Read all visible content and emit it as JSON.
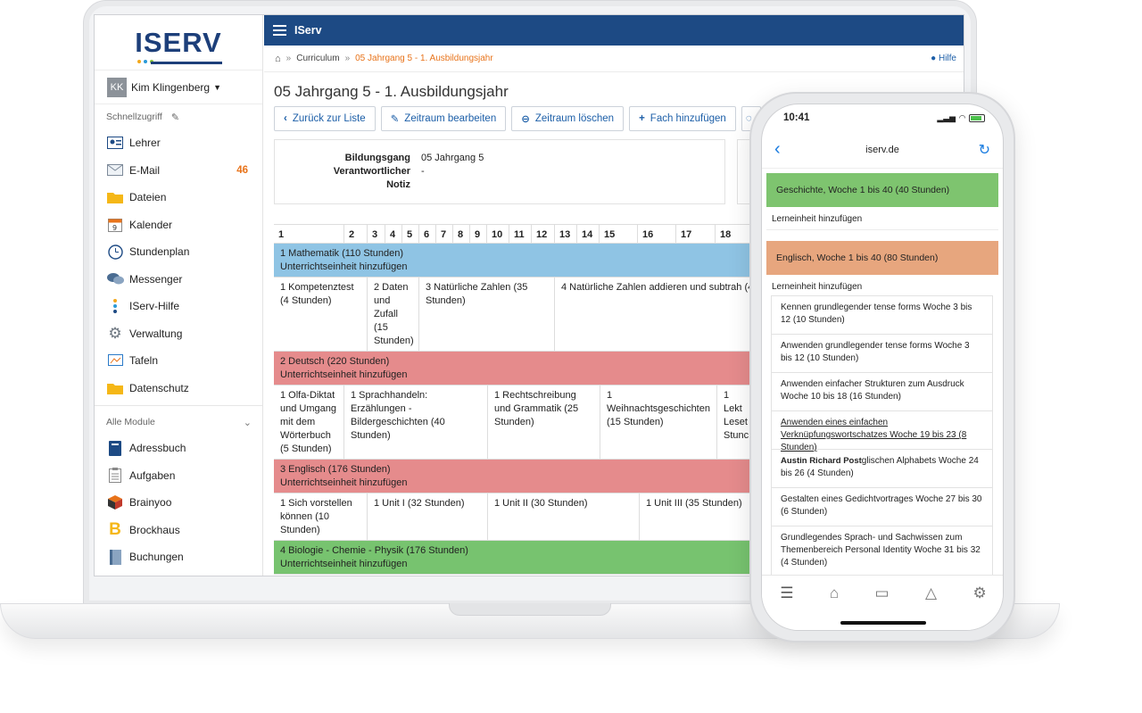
{
  "colors": {
    "brand_blue": "#1d4a84",
    "accent_orange": "#e8731a",
    "link_blue": "#1d5fa8",
    "mathematik": "#8fc4e4",
    "deutsch": "#e58b8c",
    "englisch": "#e58b8c",
    "biologie": "#77c36f",
    "phone_geschichte": "#7ec46f",
    "phone_englisch": "#e7a67e"
  },
  "sidebar": {
    "logo": "ISERV",
    "user": {
      "initials": "KK",
      "name": "Kim Klingenberg"
    },
    "quick_header": "Schnellzugriff",
    "quick_items": [
      {
        "label": "Lehrer",
        "icon": "teacher-card-icon"
      },
      {
        "label": "E-Mail",
        "icon": "envelope-icon",
        "badge": "46"
      },
      {
        "label": "Dateien",
        "icon": "folder-icon"
      },
      {
        "label": "Kalender",
        "icon": "calendar-icon"
      },
      {
        "label": "Stundenplan",
        "icon": "clock-icon"
      },
      {
        "label": "Messenger",
        "icon": "chat-bubbles-icon"
      },
      {
        "label": "IServ-Hilfe",
        "icon": "help-dots-icon"
      },
      {
        "label": "Verwaltung",
        "icon": "gear-icon"
      },
      {
        "label": "Tafeln",
        "icon": "board-icon"
      },
      {
        "label": "Datenschutz",
        "icon": "folder-icon"
      }
    ],
    "modules_header": "Alle Module",
    "module_items": [
      {
        "label": "Adressbuch",
        "icon": "address-book-icon"
      },
      {
        "label": "Aufgaben",
        "icon": "clipboard-icon"
      },
      {
        "label": "Brainyoo",
        "icon": "cube-icon"
      },
      {
        "label": "Brockhaus",
        "icon": "brockhaus-b-icon"
      },
      {
        "label": "Buchungen",
        "icon": "book-icon"
      }
    ]
  },
  "topbar": {
    "title": "IServ"
  },
  "breadcrumb": {
    "sep": "»",
    "item1": "Curriculum",
    "current": "05 Jahrgang 5 - 1. Ausbildungsjahr",
    "help": "Hilfe"
  },
  "page": {
    "title": "05 Jahrgang 5 - 1. Ausbildungsjahr",
    "buttons": [
      {
        "label": "Zurück zur Liste",
        "icon": "‹"
      },
      {
        "label": "Zeitraum bearbeiten",
        "icon": "✎"
      },
      {
        "label": "Zeitraum löschen",
        "icon": "⊖"
      },
      {
        "label": "Fach hinzufügen",
        "icon": "+"
      }
    ],
    "info": {
      "bildungsgang_label": "Bildungsgang",
      "bildungsgang": "05 Jahrgang 5",
      "verantwortlicher_label": "Verantwortlicher",
      "verantwortlicher": "-",
      "notiz_label": "Notiz",
      "notiz": ""
    }
  },
  "grid": {
    "weeks": [
      "1",
      "2",
      "3",
      "4",
      "5",
      "6",
      "7",
      "8",
      "9",
      "10",
      "11",
      "12",
      "13",
      "14",
      "15",
      "16",
      "17",
      "18"
    ],
    "add_unit": "Unterrichtseinheit hinzufügen",
    "subjects": [
      {
        "title": "1 Mathematik (110 Stunden)",
        "units": [
          "1 Kompetenztest (4 Stunden)",
          "2 Daten und Zufall (15 Stunden)",
          "3 Natürliche Zahlen (35 Stunden)",
          "4 Natürliche Zahlen addieren und subtrah (40 Stunden)"
        ]
      },
      {
        "title": "2 Deutsch (220 Stunden)",
        "units": [
          "1 Olfa-Diktat und Umgang mit dem Wörterbuch (5 Stunden)",
          "1 Sprachhandeln: Erzählungen - Bildergeschichten (40 Stunden)",
          "1 Rechtschreibung und Grammatik (25 Stunden)",
          "1 Weihnachtsgeschichten (15 Stunden)",
          "1 Lekt Leset Stunc"
        ]
      },
      {
        "title": "3 Englisch (176 Stunden)",
        "units": [
          "1 Sich vorstellen können (10 Stunden)",
          "1 Unit I (32 Stunden)",
          "1 Unit II (30 Stunden)",
          "1 Unit III (35 Stunden)"
        ]
      },
      {
        "title": "4 Biologie - Chemie - Physik (176 Stunden)"
      }
    ]
  },
  "phone": {
    "time": "10:41",
    "url": "iserv.de",
    "band1": "Geschichte, Woche 1 bis 40 (40 Stunden)",
    "link1": "Lerneinheit hinzufügen",
    "band2": "Englisch, Woche 1 bis 40 (80 Stunden)",
    "link2": "Lerneinheit hinzufügen",
    "cards": [
      "Kennen grundlegender tense forms Woche 3 bis 12 (10 Stunden)",
      "Anwenden grundlegender tense forms Woche 3 bis 12 (10 Stunden)",
      "Anwenden einfacher Strukturen zum Ausdruck Woche 10 bis 18 (16 Stunden)",
      "Anwenden eines einfachen Verknüpfungswortschatzes Woche 19 bis 23 (8 Stunden)",
      "glischen Alphabets Woche 24 bis 26 (4 Stunden)",
      "Gestalten eines Gedichtvortrages Woche 27 bis 30 (6 Stunden)",
      "Grundlegendes Sprach- und Sachwissen zum Themenbereich Personal Identity Woche 31 bis 32 (4 Stunden)"
    ],
    "tooltip": "Austin Richard Post"
  }
}
